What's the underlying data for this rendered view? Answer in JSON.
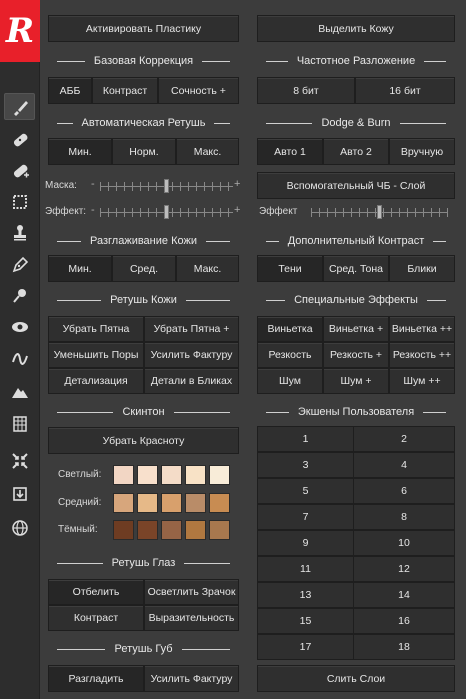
{
  "app": {
    "logo_letter": "R",
    "logo_color": "#e8202a"
  },
  "tools": [
    {
      "name": "brush-icon",
      "active": true
    },
    {
      "name": "bandage-icon",
      "active": false
    },
    {
      "name": "bandage-plus-icon",
      "active": false
    },
    {
      "name": "stamp-frame-icon",
      "active": false
    },
    {
      "name": "clone-stamp-icon",
      "active": false
    },
    {
      "name": "pen-icon",
      "active": false
    },
    {
      "name": "pin-icon",
      "active": false
    },
    {
      "name": "eye-icon",
      "active": false
    },
    {
      "name": "curve-icon",
      "active": false
    },
    {
      "name": "mountain-icon",
      "active": false
    },
    {
      "name": "pattern-icon",
      "active": false
    },
    {
      "name": "shrink-arrows-icon",
      "active": false
    },
    {
      "name": "export-icon",
      "active": false
    },
    {
      "name": "globe-icon",
      "active": false
    }
  ],
  "left": {
    "activate_plastic": "Активировать Пластику",
    "basic_correction": {
      "title": "Базовая Коррекция",
      "buttons": [
        "АББ",
        "Контраст",
        "Сочность +"
      ]
    },
    "auto_retouch": {
      "title": "Автоматическая Ретушь",
      "buttons": [
        "Мин.",
        "Норм.",
        "Макс."
      ],
      "mask_label": "Маска:",
      "effect_label": "Эффект:",
      "mask_value": 0.5,
      "effect_value": 0.5,
      "minus": "-",
      "plus": "+"
    },
    "skin_smoothing": {
      "title": "Разглаживание Кожи",
      "buttons": [
        "Мин.",
        "Сред.",
        "Макс."
      ]
    },
    "skin_retouch": {
      "title": "Ретушь Кожи",
      "buttons": [
        "Убрать Пятна",
        "Убрать Пятна +",
        "Уменьшить Поры",
        "Усилить Фактуру",
        "Детализация",
        "Детали в Бликах"
      ]
    },
    "skintone": {
      "title": "Скинтон",
      "remove_redness": "Убрать Красноту",
      "rows": [
        {
          "label": "Светлый:",
          "colors": [
            "#f2d6c4",
            "#f8e0cc",
            "#f4dcc8",
            "#f8e2c6",
            "#f8ecd8"
          ]
        },
        {
          "label": "Средний:",
          "colors": [
            "#d7a67c",
            "#e6b988",
            "#d8a06c",
            "#b98c68",
            "#c88c52"
          ]
        },
        {
          "label": "Тёмный:",
          "colors": [
            "#6e3c22",
            "#7a4428",
            "#966446",
            "#b07840",
            "#a8784e"
          ]
        }
      ]
    },
    "eye_retouch": {
      "title": "Ретушь Глаз",
      "buttons": [
        "Отбелить",
        "Осветлить Зрачок",
        "Контраст",
        "Выразительность"
      ]
    },
    "lip_retouch": {
      "title": "Ретушь Губ",
      "buttons": [
        "Разгладить",
        "Усилить Фактуру"
      ]
    }
  },
  "right": {
    "select_skin": "Выделить Кожу",
    "frequency": {
      "title": "Частотное Разложение",
      "buttons": [
        "8 бит",
        "16 бит"
      ]
    },
    "dodge_burn": {
      "title": "Dodge & Burn",
      "buttons": [
        "Авто 1",
        "Авто 2",
        "Вручную"
      ],
      "helper": "Вспомогательный ЧБ - Слой",
      "effect_label": "Эффект",
      "effect_value": 0.5
    },
    "extra_contrast": {
      "title": "Дополнительный Контраст",
      "buttons": [
        "Тени",
        "Сред. Тона",
        "Блики"
      ]
    },
    "special_effects": {
      "title": "Специальные Эффекты",
      "buttons": [
        "Виньетка",
        "Виньетка +",
        "Виньетка ++",
        "Резкость",
        "Резкость +",
        "Резкость ++",
        "Шум",
        "Шум +",
        "Шум ++"
      ]
    },
    "user_actions": {
      "title": "Экшены Пользователя",
      "items": [
        "1",
        "2",
        "3",
        "4",
        "5",
        "6",
        "7",
        "8",
        "9",
        "10",
        "11",
        "12",
        "13",
        "14",
        "15",
        "16",
        "17",
        "18"
      ]
    },
    "merge_layers": "Слить Слои"
  }
}
